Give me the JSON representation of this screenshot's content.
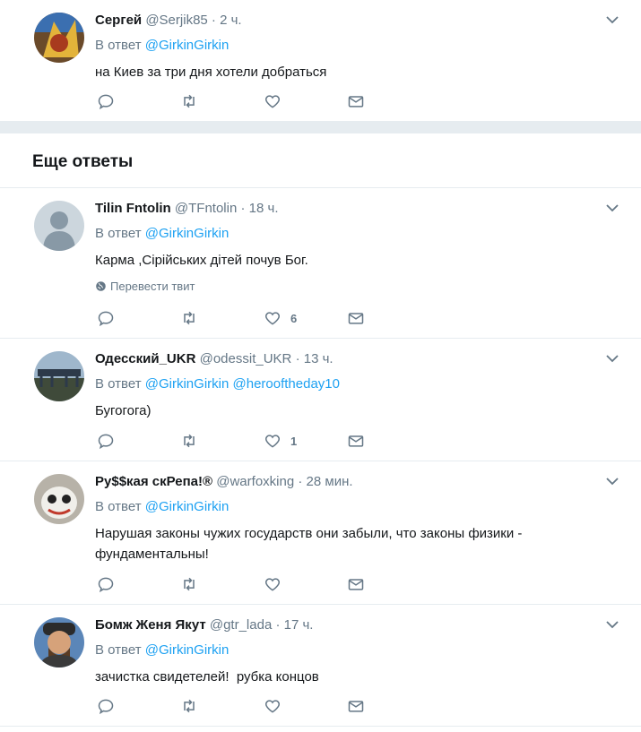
{
  "tweets": [
    {
      "name": "Сергей",
      "handle": "@Serjik85",
      "time": "2 ч.",
      "reply_prefix": "В ответ",
      "reply_to": "@GirkinGirkin",
      "text": "на Киев за три дня хотели добраться",
      "likes": ""
    },
    {
      "name": "Tilin Fntolin",
      "handle": "@TFntolin",
      "time": "18 ч.",
      "reply_prefix": "В ответ",
      "reply_to": "@GirkinGirkin",
      "text": "Карма ,Сірійських дітей почув Бог.",
      "translate": "Перевести твит",
      "likes": "6"
    },
    {
      "name": "Одесский_UKR",
      "handle": "@odessit_UKR",
      "time": "13 ч.",
      "reply_prefix": "В ответ",
      "reply_to": "@GirkinGirkin",
      "reply_to2": "@herooftheday10",
      "text": "Бугогога)",
      "likes": "1"
    },
    {
      "name": "Ру$$кая скРепа!®",
      "handle": "@warfoxking",
      "time": "28 мин.",
      "reply_prefix": "В ответ",
      "reply_to": "@GirkinGirkin",
      "text_line1": "Нарушая законы чужих государств они забыли, что законы физики -",
      "text_line2": "фундаментальны!",
      "likes": ""
    },
    {
      "name": "Бомж Женя Якут",
      "handle": "@gtr_lada",
      "time": "17 ч.",
      "reply_prefix": "В ответ",
      "reply_to": "@GirkinGirkin",
      "text": "зачистка свидетелей!  рубка концов",
      "likes": ""
    }
  ],
  "section_title": "Еще ответы",
  "separator": "·",
  "icons": [
    "reply-icon",
    "retweet-icon",
    "like-icon",
    "dm-icon",
    "chevron-down-icon",
    "globe-icon"
  ],
  "colors": {
    "link": "#1da1f2",
    "muted": "#657786",
    "text": "#14171a",
    "border": "#e6ecf0"
  }
}
